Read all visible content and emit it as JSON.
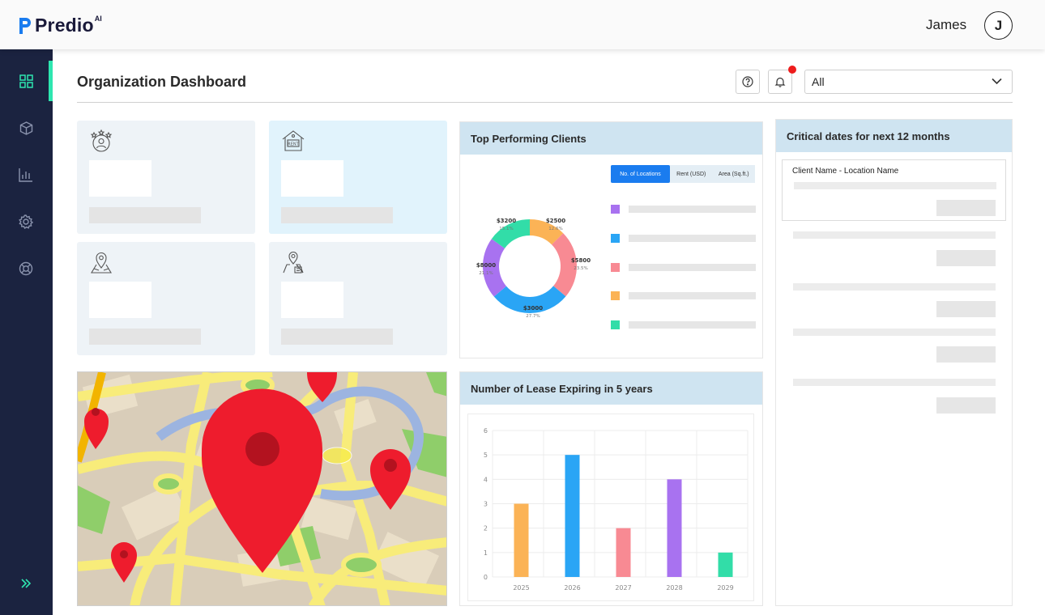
{
  "app": {
    "logo_text": "Predio",
    "logo_sup": "AI"
  },
  "user": {
    "name": "James",
    "avatar_initial": "J"
  },
  "sidebar": {
    "items": [
      {
        "icon": "dashboard-grid-icon",
        "active": true
      },
      {
        "icon": "cube-icon",
        "active": false
      },
      {
        "icon": "bar-chart-icon",
        "active": false
      },
      {
        "icon": "gear-icon",
        "active": false
      },
      {
        "icon": "lifebuoy-icon",
        "active": false
      }
    ],
    "expand_icon": "double-chevron-right-icon"
  },
  "header": {
    "title": "Organization Dashboard",
    "filter_value": "All"
  },
  "kpi_cards": [
    {
      "icon": "star-person-icon"
    },
    {
      "icon": "rent-house-icon"
    },
    {
      "icon": "location-map-icon"
    },
    {
      "icon": "location-building-icon"
    }
  ],
  "top_clients": {
    "title": "Top Performing Clients",
    "tabs": [
      "No. of Locations",
      "Rent (USD)",
      "Area (Sq.ft.)"
    ],
    "active_tab": "No. of Locations",
    "donut_labels": [
      {
        "value": "$2500",
        "pct": "12.6%"
      },
      {
        "value": "$5800",
        "pct": "23.5%"
      },
      {
        "value": "$3000",
        "pct": "27.7%"
      },
      {
        "value": "$8000",
        "pct": "21.1%"
      },
      {
        "value": "$3200",
        "pct": "15.1%"
      }
    ],
    "legend_colors": [
      "#a872f0",
      "#2aa5f5",
      "#f88a93",
      "#fbb356",
      "#32dda8"
    ]
  },
  "lease_chart": {
    "title": "Number of Lease Expiring in 5 years"
  },
  "critical": {
    "title": "Critical dates for next 12 months",
    "first_row_label": "Client Name - Location Name"
  },
  "chart_data": [
    {
      "type": "pie",
      "subtype": "donut",
      "categories": [
        "$2500",
        "$5800",
        "$3000",
        "$8000",
        "$3200"
      ],
      "values": [
        12.6,
        23.5,
        27.7,
        21.1,
        15.1
      ],
      "colors": [
        "#fbb356",
        "#f88a93",
        "#2aa5f5",
        "#a872f0",
        "#32dda8"
      ]
    },
    {
      "type": "bar",
      "title": "Number of Lease Expiring in 5 years",
      "categories": [
        "2025",
        "2026",
        "2027",
        "2028",
        "2029"
      ],
      "values": [
        3,
        5,
        2,
        4,
        1
      ],
      "colors": [
        "#fbb356",
        "#2aa5f5",
        "#f88a93",
        "#a872f0",
        "#32dda8"
      ],
      "ylim": [
        0,
        6
      ],
      "yticks": [
        "0",
        "1",
        "2",
        "3",
        "4",
        "5",
        "6"
      ],
      "grid": true
    }
  ]
}
